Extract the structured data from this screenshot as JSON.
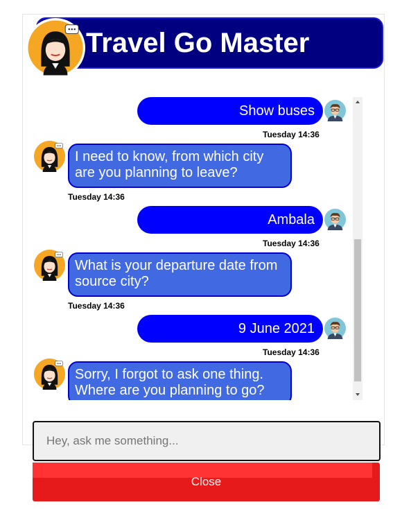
{
  "app": {
    "title": "Travel Go Master"
  },
  "messages": [
    {
      "sender": "user",
      "text": "Show buses",
      "time": "Tuesday 14:36"
    },
    {
      "sender": "bot",
      "text": "I need to know, from which city\nare you planning to leave?",
      "time": "Tuesday 14:36"
    },
    {
      "sender": "user",
      "text": "Ambala",
      "time": "Tuesday 14:36"
    },
    {
      "sender": "bot",
      "text": "What is your departure date from\nsource city?",
      "time": "Tuesday 14:36"
    },
    {
      "sender": "user",
      "text": "9 June 2021",
      "time": "Tuesday 14:36"
    },
    {
      "sender": "bot",
      "text": "Sorry, I forgot to ask one thing.\nWhere are you planning to go?",
      "time": ""
    }
  ],
  "input": {
    "placeholder": "Hey, ask me something...",
    "value": ""
  },
  "close_button": {
    "label": "Close"
  },
  "icons": {
    "bot": "bot-avatar-icon",
    "user": "user-avatar-icon"
  },
  "colors": {
    "header": "#000080",
    "user_bubble": "#0000ff",
    "bot_bubble": "#4169e1",
    "close": "#e61a1a"
  }
}
